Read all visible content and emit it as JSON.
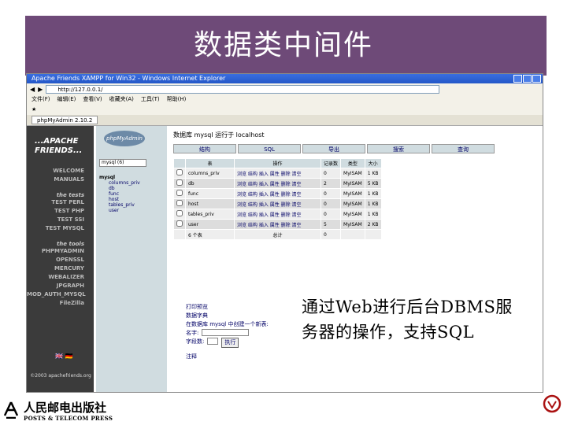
{
  "slide": {
    "title": "数据类中间件",
    "callout_line1": "通过Web进行后台DBMS服",
    "callout_line2": "务器的操作，支持SQL",
    "publisher_cn": "人民邮电出版社",
    "publisher_en": "POSTS & TELECOM PRESS"
  },
  "browser": {
    "window_title": "Apache Friends XAMPP for Win32 - Windows Internet Explorer",
    "address": "http://127.0.0.1/",
    "menu": [
      "文件(F)",
      "编辑(E)",
      "查看(V)",
      "收藏夹(A)",
      "工具(T)",
      "帮助(H)"
    ],
    "tab_label": "phpMyAdmin 2.10.2"
  },
  "xampp": {
    "logo_line1": "...APACHE",
    "logo_line2": "FRIENDS...",
    "links_top": [
      "WELCOME",
      "MANUALS"
    ],
    "tests_heading": "the tests",
    "tests": [
      "TEST PERL",
      "TEST PHP",
      "TEST SSI",
      "TEST MYSQL"
    ],
    "tools_heading": "the tools",
    "tools": [
      "PHPMYADMIN",
      "OPENSSL",
      "MERCURY",
      "WEBALIZER",
      "JPGRAPH",
      "MOD_AUTH_MYSQL",
      "FileZilla"
    ],
    "footer": "©2003 apachefriends.org"
  },
  "pma": {
    "logo": "phpMyAdmin",
    "db_select": "mysql (6)",
    "db_name": "mysql",
    "tree": [
      "columns_priv",
      "db",
      "func",
      "host",
      "tables_priv",
      "user"
    ],
    "header": "数据库 mysql 运行于 localhost",
    "tabs": [
      "结构",
      "SQL",
      "导出",
      "搜索",
      "查询"
    ],
    "columns": [
      "表",
      "操作",
      "记录数",
      "类型",
      "大小"
    ],
    "rows": [
      {
        "name": "columns_priv",
        "records": "0",
        "type": "MyISAM",
        "size": "1 KB"
      },
      {
        "name": "db",
        "records": "2",
        "type": "MyISAM",
        "size": "5 KB"
      },
      {
        "name": "func",
        "records": "0",
        "type": "MyISAM",
        "size": "1 KB"
      },
      {
        "name": "host",
        "records": "0",
        "type": "MyISAM",
        "size": "1 KB"
      },
      {
        "name": "tables_priv",
        "records": "0",
        "type": "MyISAM",
        "size": "1 KB"
      },
      {
        "name": "user",
        "records": "5",
        "type": "MyISAM",
        "size": "2 KB"
      }
    ],
    "actions": "浏览 结构 插入 属性 删除 清空",
    "total_label": "6 个表",
    "total_sum": "总计",
    "total_records": "0",
    "op_links": [
      "打印预览",
      "数据字典",
      "在数据库 mysql 中创建一个新表:",
      "名字:",
      "字段数:",
      "执行",
      "注释"
    ]
  }
}
